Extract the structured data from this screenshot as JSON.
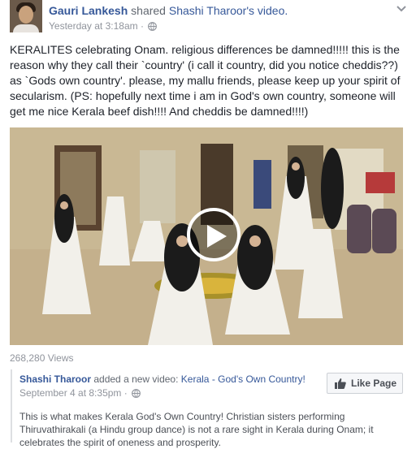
{
  "post": {
    "author": "Gauri Lankesh",
    "shared_verb": "shared",
    "shared_link": "Shashi Tharoor's video.",
    "timestamp": "Yesterday at 3:18am",
    "separator": "·",
    "text": "KERALITES celebrating Onam. religious differences be damned!!!!! this is the reason why they call their `country' (i call it country, did you notice cheddis??) as `Gods own country'. please, my mallu friends, please keep up your spirit of secularism. (PS: hopefully next time i am in God's own country, someone will get me nice Kerala beef dish!!!! And cheddis be damned!!!!)"
  },
  "video": {
    "views": "268,280 Views"
  },
  "original": {
    "author": "Shashi Tharoor",
    "verb": "added a new video:",
    "title": "Kerala - God's Own Country!",
    "date": "September 4 at 8:35pm",
    "separator": "·",
    "like_page_label": "Like Page",
    "text": "This is what makes Kerala God's Own Country! Christian sisters performing Thiruvathirakali (a Hindu group dance) is not a rare sight in Kerala during Onam; it celebrates the spirit of oneness and prosperity."
  }
}
